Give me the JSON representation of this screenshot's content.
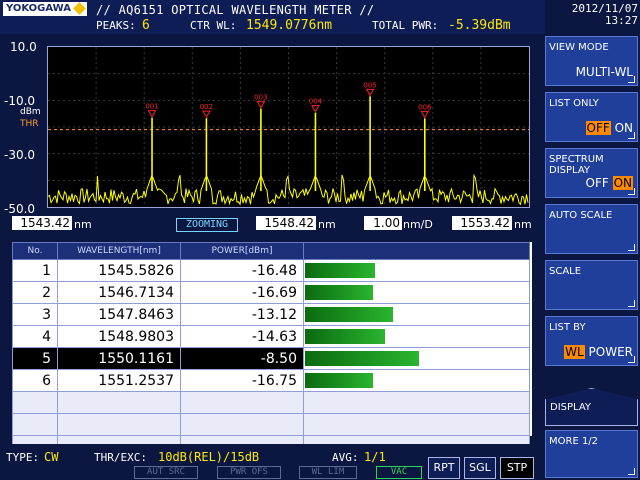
{
  "header": {
    "brand": "YOKOGAWA",
    "title": "// AQ6151 OPTICAL WAVELENGTH METER //",
    "peaks_label": "PEAKS:",
    "peaks_value": "6",
    "ctr_label": "CTR WL:",
    "ctr_value": "1549.0776nm",
    "pwr_label": "TOTAL PWR:",
    "pwr_value": "-5.39dBm",
    "date": "2012/11/07",
    "time": "13:27"
  },
  "plot": {
    "y_ticks": [
      "10.0",
      "-10.0",
      "-30.0",
      "-50.0"
    ],
    "y_unit": "dBm",
    "thr_label": "THR",
    "x_start": "1543.42",
    "x_center": "1548.42",
    "x_div": "1.00",
    "x_end": "1553.42",
    "unit_nm": "nm",
    "unit_nmd": "nm/D",
    "zoom_label": "ZOOMING",
    "peaks": [
      {
        "label": "001",
        "wl": 1545.5826,
        "pwr": -16.48
      },
      {
        "label": "002",
        "wl": 1546.7134,
        "pwr": -16.69
      },
      {
        "label": "003",
        "wl": 1547.8463,
        "pwr": -13.12
      },
      {
        "label": "004",
        "wl": 1548.9803,
        "pwr": -14.63
      },
      {
        "label": "005",
        "wl": 1550.1161,
        "pwr": -8.5
      },
      {
        "label": "006",
        "wl": 1551.2537,
        "pwr": -16.75
      }
    ],
    "ymin": -50,
    "ymax": 10,
    "xmin": 1543.42,
    "xmax": 1553.42,
    "thr_level": -21
  },
  "table": {
    "headers": [
      "No.",
      "WAVELENGTH[nm]",
      "POWER[dBm]",
      ""
    ],
    "rows": [
      {
        "no": "1",
        "wl": "1545.5826",
        "pwr": "-16.48",
        "bar": 0.41
      },
      {
        "no": "2",
        "wl": "1546.7134",
        "pwr": "-16.69",
        "bar": 0.4
      },
      {
        "no": "3",
        "wl": "1547.8463",
        "pwr": "-13.12",
        "bar": 0.52
      },
      {
        "no": "4",
        "wl": "1548.9803",
        "pwr": "-14.63",
        "bar": 0.47
      },
      {
        "no": "5",
        "wl": "1550.1161",
        "pwr": "-8.50",
        "bar": 0.67
      },
      {
        "no": "6",
        "wl": "1551.2537",
        "pwr": "-16.75",
        "bar": 0.4
      }
    ],
    "selected_row": 4
  },
  "menu": {
    "view_mode": {
      "label": "VIEW MODE",
      "value": "MULTI-WL"
    },
    "list_only": {
      "label": "LIST ONLY",
      "off": "OFF",
      "on": "ON"
    },
    "spectrum": {
      "label1": "SPECTRUM",
      "label2": "DISPLAY",
      "off": "OFF",
      "on": "ON"
    },
    "auto_scale": {
      "label": "AUTO SCALE"
    },
    "scale": {
      "label": "SCALE"
    },
    "list_by": {
      "label": "LIST BY",
      "wl": "WL",
      "power": "POWER"
    },
    "display": {
      "label": "DISPLAY"
    },
    "more": {
      "label": "MORE 1/2"
    }
  },
  "footer": {
    "type_label": "TYPE:",
    "type_value": "CW",
    "thr_label": "THR/EXC:",
    "thr_value": "10dB(REL)/15dB",
    "avg_label": "AVG:",
    "avg_value": "1/1",
    "aut_src": "AUT SRC",
    "pwr_ofs": "PWR OFS",
    "wl_lim": "WL LIM",
    "vac": "VAC",
    "rpt": "RPT",
    "sgl": "SGL",
    "stp": "STP"
  },
  "colors": {
    "trace": "#ffff00",
    "peak_marker": "#ff2020",
    "thr": "#ff9a2a",
    "bar": "#1a9a20"
  }
}
